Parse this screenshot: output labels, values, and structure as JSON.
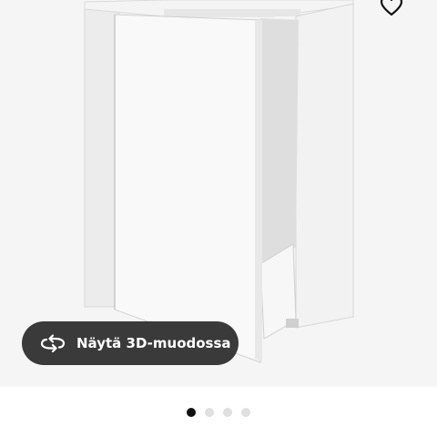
{
  "gallery": {
    "view_3d_label": "Näytä 3D-muodossa",
    "view_3d_icon": "rotate-3d-icon",
    "favorite_icon": "heart-icon",
    "pager": {
      "total": 4,
      "active_index": 0
    },
    "colors": {
      "button_bg": "#3a3a3a",
      "button_text": "#ffffff",
      "image_bg": "#f5f5f5",
      "dot_active": "#111111",
      "dot_inactive": "#dfdfdf"
    }
  }
}
